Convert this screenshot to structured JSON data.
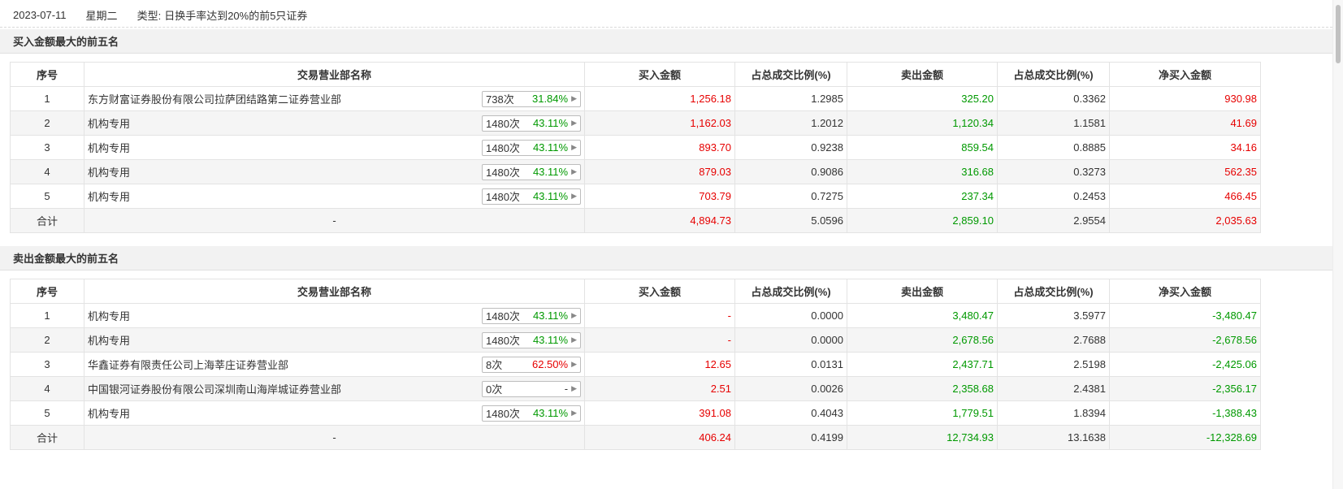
{
  "header": {
    "date": "2023-07-11",
    "weekday": "星期二",
    "type_label": "类型:",
    "type_value": "日换手率达到20%的前5只证券"
  },
  "columns": [
    "序号",
    "交易营业部名称",
    "买入金额",
    "占总成交比例(%)",
    "卖出金额",
    "占总成交比例(%)",
    "净买入金额"
  ],
  "buy_section": {
    "title": "买入金额最大的前五名",
    "rows": [
      {
        "idx": "1",
        "name": "东方财富证券股份有限公司拉萨团结路第二证券营业部",
        "count": "738次",
        "pct": "31.84%",
        "pct_color": "green",
        "buy": "1,256.18",
        "buy_ratio": "1.2985",
        "sell": "325.20",
        "sell_ratio": "0.3362",
        "net": "930.98",
        "net_color": "red"
      },
      {
        "idx": "2",
        "name": "机构专用",
        "count": "1480次",
        "pct": "43.11%",
        "pct_color": "green",
        "buy": "1,162.03",
        "buy_ratio": "1.2012",
        "sell": "1,120.34",
        "sell_ratio": "1.1581",
        "net": "41.69",
        "net_color": "red"
      },
      {
        "idx": "3",
        "name": "机构专用",
        "count": "1480次",
        "pct": "43.11%",
        "pct_color": "green",
        "buy": "893.70",
        "buy_ratio": "0.9238",
        "sell": "859.54",
        "sell_ratio": "0.8885",
        "net": "34.16",
        "net_color": "red"
      },
      {
        "idx": "4",
        "name": "机构专用",
        "count": "1480次",
        "pct": "43.11%",
        "pct_color": "green",
        "buy": "879.03",
        "buy_ratio": "0.9086",
        "sell": "316.68",
        "sell_ratio": "0.3273",
        "net": "562.35",
        "net_color": "red"
      },
      {
        "idx": "5",
        "name": "机构专用",
        "count": "1480次",
        "pct": "43.11%",
        "pct_color": "green",
        "buy": "703.79",
        "buy_ratio": "0.7275",
        "sell": "237.34",
        "sell_ratio": "0.2453",
        "net": "466.45",
        "net_color": "red"
      }
    ],
    "total": {
      "label": "合计",
      "name": "-",
      "buy": "4,894.73",
      "buy_ratio": "5.0596",
      "sell": "2,859.10",
      "sell_ratio": "2.9554",
      "net": "2,035.63",
      "net_color": "red"
    }
  },
  "sell_section": {
    "title": "卖出金额最大的前五名",
    "rows": [
      {
        "idx": "1",
        "name": "机构专用",
        "count": "1480次",
        "pct": "43.11%",
        "pct_color": "green",
        "buy": "-",
        "buy_ratio": "0.0000",
        "sell": "3,480.47",
        "sell_ratio": "3.5977",
        "net": "-3,480.47",
        "net_color": "green"
      },
      {
        "idx": "2",
        "name": "机构专用",
        "count": "1480次",
        "pct": "43.11%",
        "pct_color": "green",
        "buy": "-",
        "buy_ratio": "0.0000",
        "sell": "2,678.56",
        "sell_ratio": "2.7688",
        "net": "-2,678.56",
        "net_color": "green"
      },
      {
        "idx": "3",
        "name": "华鑫证券有限责任公司上海莘庄证券营业部",
        "count": "8次",
        "pct": "62.50%",
        "pct_color": "red",
        "buy": "12.65",
        "buy_ratio": "0.0131",
        "sell": "2,437.71",
        "sell_ratio": "2.5198",
        "net": "-2,425.06",
        "net_color": "green"
      },
      {
        "idx": "4",
        "name": "中国银河证券股份有限公司深圳南山海岸城证券营业部",
        "count": "0次",
        "pct": "-",
        "pct_color": "gray",
        "buy": "2.51",
        "buy_ratio": "0.0026",
        "sell": "2,358.68",
        "sell_ratio": "2.4381",
        "net": "-2,356.17",
        "net_color": "green"
      },
      {
        "idx": "5",
        "name": "机构专用",
        "count": "1480次",
        "pct": "43.11%",
        "pct_color": "green",
        "buy": "391.08",
        "buy_ratio": "0.4043",
        "sell": "1,779.51",
        "sell_ratio": "1.8394",
        "net": "-1,388.43",
        "net_color": "green"
      }
    ],
    "total": {
      "label": "合计",
      "name": "-",
      "buy": "406.24",
      "buy_ratio": "0.4199",
      "sell": "12,734.93",
      "sell_ratio": "13.1638",
      "net": "-12,328.69",
      "net_color": "green"
    }
  },
  "icons": {
    "stat_arrow": "caret-right-icon"
  },
  "colors": {
    "red": "#e60000",
    "green": "#009900",
    "gray": "#333333"
  }
}
